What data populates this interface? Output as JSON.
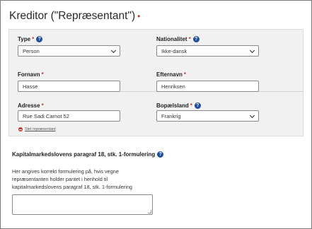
{
  "section": {
    "title": "Kreditor (\"Repræsentant\")",
    "required_marker": "•"
  },
  "form": {
    "type": {
      "label": "Type",
      "required": "*",
      "value": "Person"
    },
    "nationalitet": {
      "label": "Nationalitet",
      "required": "*",
      "value": "Ikke-dansk"
    },
    "fornavn": {
      "label": "Fornavn",
      "required": "*",
      "value": "Hasse"
    },
    "efternavn": {
      "label": "Efternavn",
      "required": "*",
      "value": "Henriksen"
    },
    "adresse": {
      "label": "Adresse",
      "required": "*",
      "value": "Rue Sadi Carnot 52"
    },
    "bopaelsland": {
      "label": "Bopælsland",
      "required": "*",
      "value": "Frankrig"
    },
    "remove_link": "Slet repræsentant"
  },
  "kapital": {
    "heading": "Kapitalmarkedslovens paragraf 18, stk. 1-formulering",
    "description": "Her angives korrekt formulering på, hvis vegne repræsentanten holder pantet i henhold til kapitalmarkedslovens paragraf 18, stk. 1-formulering",
    "textarea_value": ""
  },
  "help_icon_glyph": "?",
  "colors": {
    "accent": "#1f4e9c",
    "required": "#c0392b",
    "panel_bg": "#f1f1f1"
  }
}
